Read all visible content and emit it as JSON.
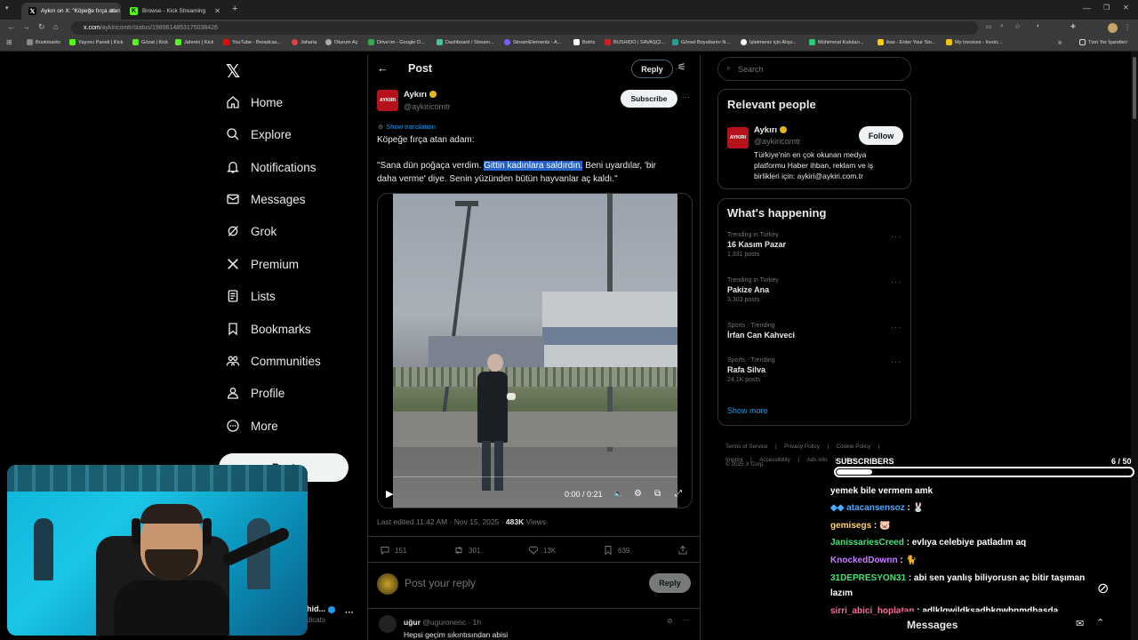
{
  "browser": {
    "tabs": [
      {
        "title": "Aykırı on X: \"Köpeğe fırça atan",
        "icon": "x-icon"
      },
      {
        "title": "Browse - Kick Streaming",
        "icon": "kick-icon"
      }
    ],
    "new_tab": "+",
    "url_main": "x.com",
    "url_path": "/aykiricomtr/status/1989614853175038426",
    "bookmarks": [
      {
        "label": "Bookmarks",
        "color": "#888888"
      },
      {
        "label": "Yayıncı Paneli | Kick",
        "color": "#53fc18"
      },
      {
        "label": "Gözat | Kick",
        "color": "#53fc18"
      },
      {
        "label": "Jahrein | Kick",
        "color": "#53fc18"
      },
      {
        "label": "YouTube - Broadcas...",
        "color": "#ff0000"
      },
      {
        "label": "Jaharia",
        "color": "#e04040"
      },
      {
        "label": "Oturum Aç",
        "color": "#aaaaaa"
      },
      {
        "label": "Drive'ım - Google D...",
        "color": "#34a853"
      },
      {
        "label": "Dashboard / Stream...",
        "color": "#44c4a1"
      },
      {
        "label": "StreamElements - A...",
        "color": "#7b5cff"
      },
      {
        "label": "Botrix",
        "color": "#ffffff"
      },
      {
        "label": "BUSHIDO | SAVAŞÇI...",
        "color": "#cc2222"
      },
      {
        "label": "Görsel Boyutlarını N...",
        "color": "#2a9d8f"
      },
      {
        "label": "İşletmeniz için Alışv...",
        "color": "#ffffff"
      },
      {
        "label": "Mühimmat Kutuları...",
        "color": "#2ecc71"
      },
      {
        "label": "ikas - Enter Your Sto...",
        "color": "#ffcc00"
      },
      {
        "label": "My Invoices - Invoic...",
        "color": "#f1c40f"
      }
    ],
    "bookmarks_more": "»",
    "all_bookmarks": "Tüm Yer İşaretleri"
  },
  "x": {
    "nav": [
      {
        "label": "Home",
        "icon": "home-icon"
      },
      {
        "label": "Explore",
        "icon": "search-icon"
      },
      {
        "label": "Notifications",
        "icon": "bell-icon"
      },
      {
        "label": "Messages",
        "icon": "mail-icon"
      },
      {
        "label": "Grok",
        "icon": "grok-icon"
      },
      {
        "label": "Premium",
        "icon": "x-premium-icon"
      },
      {
        "label": "Lists",
        "icon": "list-icon"
      },
      {
        "label": "Bookmarks",
        "icon": "bookmark-icon"
      },
      {
        "label": "Communities",
        "icon": "communities-icon"
      },
      {
        "label": "Profile",
        "icon": "profile-icon"
      },
      {
        "label": "More",
        "icon": "more-circle-icon"
      }
    ],
    "post_button": "Post",
    "account": {
      "name_partial": "hid...",
      "handle_partial": "dicats"
    },
    "header": {
      "title": "Post",
      "reply_button": "Reply"
    },
    "post": {
      "avatar_text": "AYKIRI",
      "author": "Aykırı",
      "handle": "@aykiricomtr",
      "subscribe": "Subscribe",
      "show_translation": "Show translation",
      "line1": "Köpeğe fırça atan adam:",
      "line2_a": "\"Sana dün poğaça verdim.",
      "line2_hl": "Gittin kadınlara saldırdın.",
      "line2_b": "Beni uyardılar, 'bir",
      "line3": "daha verme' diye. Senin yüzünden bütün hayvanlar aç kaldı.\"",
      "video_time": "0:00 / 0:21",
      "edited": "Last edited 11:42 AM · Nov 15, 2025 ·",
      "views_count": "483K",
      "views_label": "Views",
      "replies": "151",
      "reposts": "301",
      "likes": "13K",
      "bookmarks": "639"
    },
    "reply_box": {
      "placeholder": "Post your reply",
      "button": "Reply"
    },
    "first_reply": {
      "author": "uğur",
      "handle": "@uguronenc · 1h",
      "text": "Hepsi geçim sıkıntısından abisi"
    },
    "search_placeholder": "Search",
    "relevant": {
      "title": "Relevant people",
      "name": "Aykırı",
      "handle": "@aykiricomtr",
      "follow": "Follow",
      "bio1": "Türkiye'nin en çok okunan medya",
      "bio2": "platformu Haber ihban, reklam ve iş",
      "bio3": "birlikleri için: aykiri@aykiri.com.tr"
    },
    "happening": {
      "title": "What's happening",
      "trends": [
        {
          "category": "Trending in Turkey",
          "name": "16 Kasım Pazar",
          "count": "1,331 posts"
        },
        {
          "category": "Trending in Turkey",
          "name": "Pakize Ana",
          "count": "3,303 posts"
        },
        {
          "category": "Sports · Trending",
          "name": "İrfan Can Kahveci",
          "count": ""
        },
        {
          "category": "Sports · Trending",
          "name": "Rafa Silva",
          "count": "24.1K posts"
        }
      ],
      "show_more": "Show more"
    },
    "footer": {
      "terms": "Terms of Service",
      "privacy": "Privacy Policy",
      "cookie": "Cookie Policy",
      "imprint": "Imprint",
      "accessibility": "Accessibility",
      "ads": "Ads info",
      "more": "More ...",
      "copyright": "© 2025 X Corp."
    },
    "messages_drawer": "Messages"
  },
  "overlay": {
    "subs_label": "SUBSCRIBERS",
    "subs_count": "6 / 50",
    "subs_progress": 0.12,
    "chat": [
      {
        "user": "",
        "user_color": "#ffffff",
        "text": "yemek bile vermem amk"
      },
      {
        "user": "atacansensoz",
        "user_color": "#4aa8ff",
        "text": " : 🐰"
      },
      {
        "user": "gemisegs",
        "user_color": "#ffd36a",
        "text": " : 🐷"
      },
      {
        "user": "JanissariesCreed",
        "user_color": "#46e07a",
        "text": " : evlıya celebiye patladım aq"
      },
      {
        "user": "KnockedDownn",
        "user_color": "#c77dff",
        "text": " : 🐈"
      },
      {
        "user": "31DEPRESYON31",
        "user_color": "#46e07a",
        "text": " : abi sen yanlış biliyorusn aç bitir taşıman"
      },
      {
        "user": "",
        "user_color": "#ffffff",
        "text": "lazım"
      },
      {
        "user": "sirri_abici_hoplatan",
        "user_color": "#ff6b9a",
        "text": " : adlklqwjldksadhkqwbnmdbasda"
      }
    ]
  }
}
